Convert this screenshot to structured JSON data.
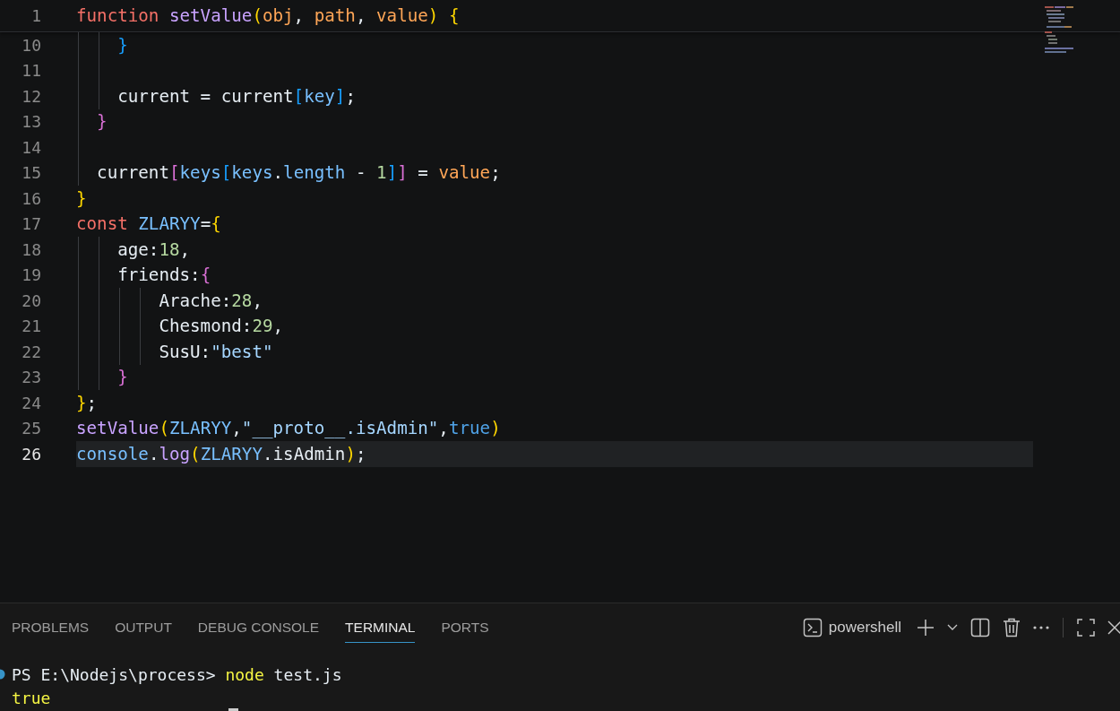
{
  "editor": {
    "sticky_line": {
      "number": "1",
      "tokens": [
        {
          "text": "function ",
          "kind": "keyword"
        },
        {
          "text": "setValue",
          "kind": "function"
        },
        {
          "text": "(",
          "kind": "bracket1"
        },
        {
          "text": "obj",
          "kind": "param"
        },
        {
          "text": ", ",
          "kind": "plain"
        },
        {
          "text": "path",
          "kind": "param"
        },
        {
          "text": ", ",
          "kind": "plain"
        },
        {
          "text": "value",
          "kind": "param"
        },
        {
          "text": ")",
          "kind": "bracket1"
        },
        {
          "text": " {",
          "kind": "bracket1"
        }
      ]
    },
    "lines": [
      {
        "number": "10",
        "selected": false,
        "tokens": [
          {
            "text": "    }",
            "kind": "bracket3"
          }
        ]
      },
      {
        "number": "11",
        "selected": false
      },
      {
        "number": "12",
        "selected": false,
        "tokens": [
          {
            "text": "    current = current",
            "kind": "plain"
          },
          {
            "text": "[",
            "kind": "bracket3"
          },
          {
            "text": "key",
            "kind": "constant"
          },
          {
            "text": "]",
            "kind": "bracket3"
          },
          {
            "text": ";",
            "kind": "plain"
          }
        ]
      },
      {
        "number": "13",
        "selected": false,
        "tokens": [
          {
            "text": "  }",
            "kind": "bracket2"
          }
        ]
      },
      {
        "number": "14",
        "selected": false
      },
      {
        "number": "15",
        "selected": false,
        "tokens": [
          {
            "text": "  current",
            "kind": "plain"
          },
          {
            "text": "[",
            "kind": "bracket2"
          },
          {
            "text": "keys",
            "kind": "constant"
          },
          {
            "text": "[",
            "kind": "bracket3"
          },
          {
            "text": "keys",
            "kind": "constant"
          },
          {
            "text": ".",
            "kind": "plain"
          },
          {
            "text": "length",
            "kind": "constant"
          },
          {
            "text": " - ",
            "kind": "plain"
          },
          {
            "text": "1",
            "kind": "number"
          },
          {
            "text": "]",
            "kind": "bracket3"
          },
          {
            "text": "]",
            "kind": "bracket2"
          },
          {
            "text": " = ",
            "kind": "plain"
          },
          {
            "text": "value",
            "kind": "param"
          },
          {
            "text": ";",
            "kind": "plain"
          }
        ]
      },
      {
        "number": "16",
        "selected": false,
        "tokens": [
          {
            "text": "}",
            "kind": "bracket1"
          }
        ]
      },
      {
        "number": "17",
        "selected": false,
        "tokens": [
          {
            "text": "const ",
            "kind": "keyword"
          },
          {
            "text": "ZLARYY",
            "kind": "constant"
          },
          {
            "text": "=",
            "kind": "plain"
          },
          {
            "text": "{",
            "kind": "bracket1"
          }
        ]
      },
      {
        "number": "18",
        "selected": false,
        "tokens": [
          {
            "text": "    age:",
            "kind": "plain"
          },
          {
            "text": "18",
            "kind": "number"
          },
          {
            "text": ",",
            "kind": "plain"
          }
        ]
      },
      {
        "number": "19",
        "selected": false,
        "tokens": [
          {
            "text": "    friends:",
            "kind": "plain"
          },
          {
            "text": "{",
            "kind": "bracket2"
          }
        ]
      },
      {
        "number": "20",
        "selected": false,
        "tokens": [
          {
            "text": "        Arache:",
            "kind": "plain"
          },
          {
            "text": "28",
            "kind": "number"
          },
          {
            "text": ",",
            "kind": "plain"
          }
        ]
      },
      {
        "number": "21",
        "selected": false,
        "tokens": [
          {
            "text": "        Chesmond:",
            "kind": "plain"
          },
          {
            "text": "29",
            "kind": "number"
          },
          {
            "text": ",",
            "kind": "plain"
          }
        ]
      },
      {
        "number": "22",
        "selected": false,
        "tokens": [
          {
            "text": "        SusU:",
            "kind": "plain"
          },
          {
            "text": "\"best\"",
            "kind": "string"
          }
        ]
      },
      {
        "number": "23",
        "selected": false,
        "tokens": [
          {
            "text": "    }",
            "kind": "bracket2"
          }
        ]
      },
      {
        "number": "24",
        "selected": false,
        "tokens": [
          {
            "text": "}",
            "kind": "bracket1"
          },
          {
            "text": ";",
            "kind": "plain"
          }
        ]
      },
      {
        "number": "25",
        "selected": false,
        "tokens": [
          {
            "text": "setValue",
            "kind": "function"
          },
          {
            "text": "(",
            "kind": "bracket1"
          },
          {
            "text": "ZLARYY",
            "kind": "constant"
          },
          {
            "text": ",",
            "kind": "plain"
          },
          {
            "text": "\"__proto__.isAdmin\"",
            "kind": "string"
          },
          {
            "text": ",",
            "kind": "plain"
          },
          {
            "text": "true",
            "kind": "boolean"
          },
          {
            "text": ")",
            "kind": "bracket1"
          }
        ]
      },
      {
        "number": "26",
        "selected": true,
        "tokens": [
          {
            "text": "console",
            "kind": "constant"
          },
          {
            "text": ".",
            "kind": "plain"
          },
          {
            "text": "log",
            "kind": "function"
          },
          {
            "text": "(",
            "kind": "bracket1"
          },
          {
            "text": "ZLARYY",
            "kind": "constant"
          },
          {
            "text": ".",
            "kind": "plain"
          },
          {
            "text": "isAdmin",
            "kind": "plain"
          },
          {
            "text": ")",
            "kind": "bracket1"
          },
          {
            "text": ";",
            "kind": "plain"
          }
        ]
      }
    ]
  },
  "panel": {
    "tabs": [
      {
        "label": "PROBLEMS",
        "selected": false
      },
      {
        "label": "OUTPUT",
        "selected": false
      },
      {
        "label": "DEBUG CONSOLE",
        "selected": false
      },
      {
        "label": "TERMINAL",
        "selected": true
      },
      {
        "label": "PORTS",
        "selected": false
      }
    ],
    "terminal_name": "powershell",
    "terminal_lines": [
      {
        "tokens": [
          {
            "text": "PS E:\\Nodejs\\process> ",
            "kind": "plain"
          },
          {
            "text": "node",
            "kind": "command"
          },
          {
            "text": " test.js",
            "kind": "plain"
          }
        ]
      },
      {
        "tokens": [
          {
            "text": "true",
            "kind": "command"
          }
        ]
      }
    ]
  }
}
